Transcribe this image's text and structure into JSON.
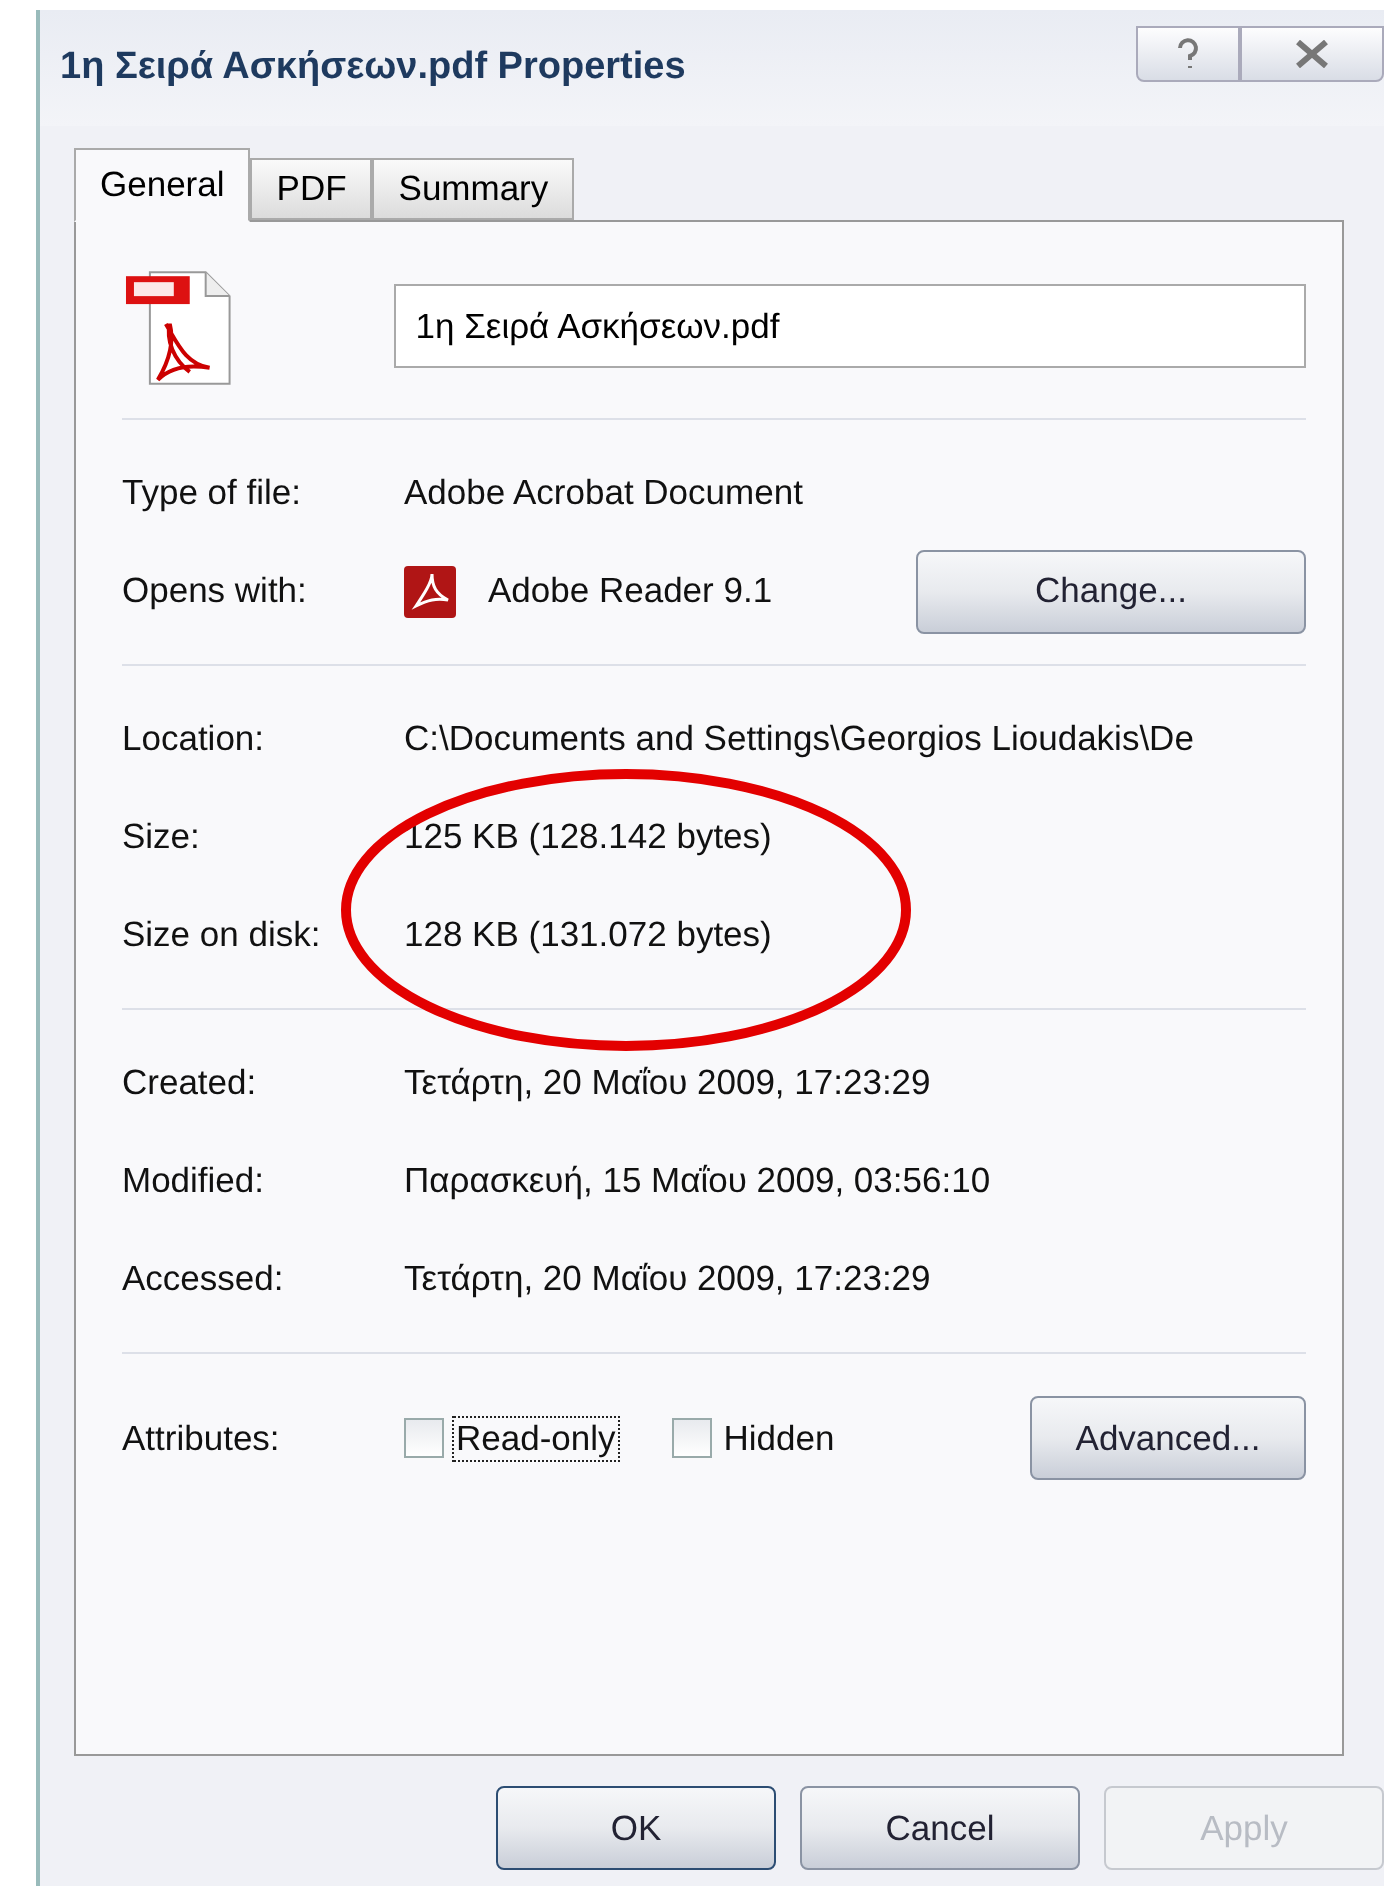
{
  "window": {
    "title": "1η Σειρά Ασκήσεων.pdf Properties"
  },
  "tabs": [
    {
      "label": "General",
      "selected": true
    },
    {
      "label": "PDF",
      "selected": false
    },
    {
      "label": "Summary",
      "selected": false
    }
  ],
  "file_name": {
    "value": "1η Σειρά Ασκήσεων.pdf"
  },
  "sections": [
    {
      "rows": [
        {
          "kind": "text",
          "label": "Type of file:",
          "value": "Adobe Acrobat Document"
        },
        {
          "kind": "app",
          "label": "Opens with:",
          "value": "Adobe Reader 9.1",
          "button": "Change..."
        }
      ]
    },
    {
      "rows": [
        {
          "kind": "text",
          "label": "Location:",
          "value": "C:\\Documents and Settings\\Georgios Lioudakis\\De"
        },
        {
          "kind": "text",
          "label": "Size:",
          "value": "125 KB (128.142 bytes)"
        },
        {
          "kind": "text",
          "label": "Size on disk:",
          "value": "128 KB (131.072 bytes)"
        }
      ]
    },
    {
      "rows": [
        {
          "kind": "text",
          "label": "Created:",
          "value": "Τετάρτη, 20 Μαΐου 2009, 17:23:29"
        },
        {
          "kind": "text",
          "label": "Modified:",
          "value": "Παρασκευή, 15 Μαΐου 2009, 03:56:10"
        },
        {
          "kind": "text",
          "label": "Accessed:",
          "value": "Τετάρτη, 20 Μαΐου 2009, 17:23:29"
        }
      ]
    }
  ],
  "attributes": {
    "label": "Attributes:",
    "options": [
      {
        "label": "Read-only",
        "checked": false,
        "focused": true
      },
      {
        "label": "Hidden",
        "checked": false,
        "focused": false
      }
    ],
    "button": "Advanced..."
  },
  "buttons": [
    {
      "label": "OK",
      "disabled": false,
      "default": true
    },
    {
      "label": "Cancel",
      "disabled": false,
      "default": false
    },
    {
      "label": "Apply",
      "disabled": true,
      "default": false
    }
  ]
}
